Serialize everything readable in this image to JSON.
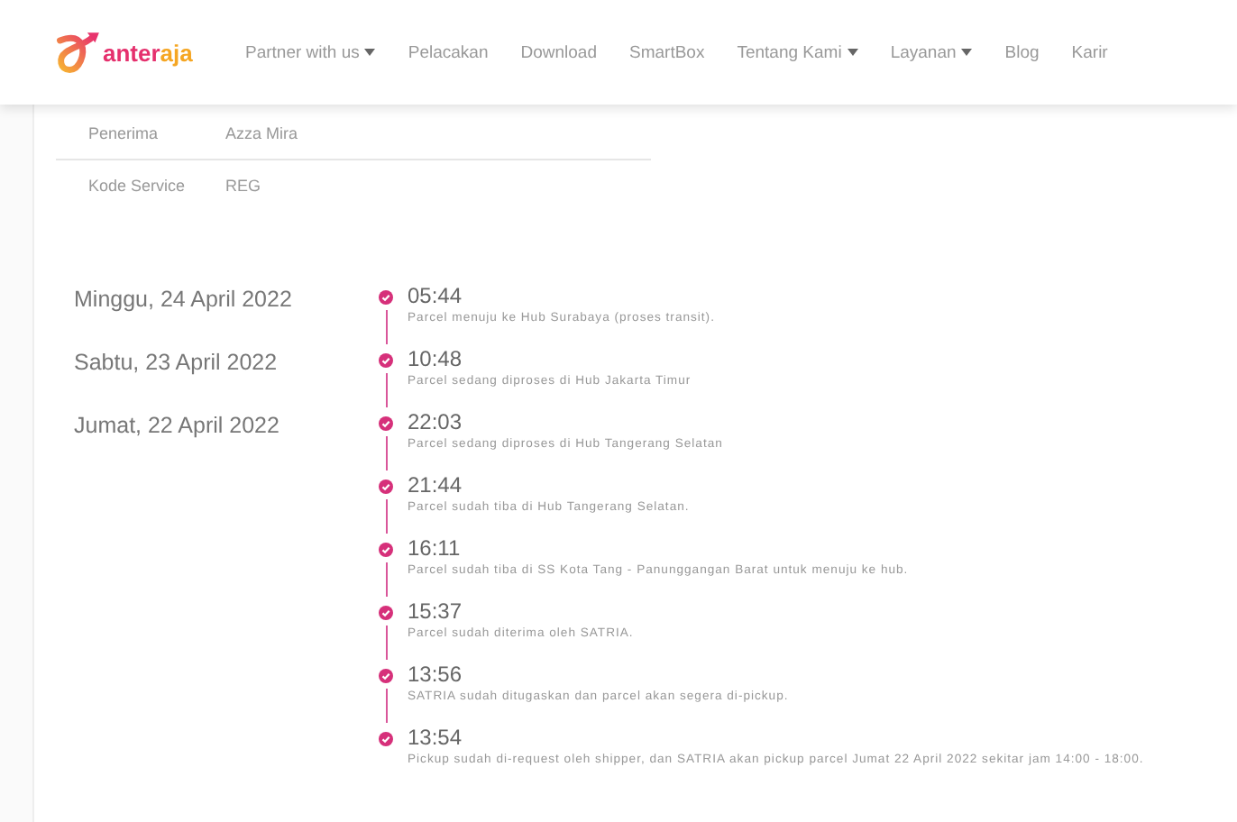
{
  "brand": {
    "parts": [
      "anter",
      "aja"
    ]
  },
  "nav": [
    {
      "label": "Partner with us",
      "dropdown": true
    },
    {
      "label": "Pelacakan",
      "dropdown": false
    },
    {
      "label": "Download",
      "dropdown": false
    },
    {
      "label": "SmartBox",
      "dropdown": false
    },
    {
      "label": "Tentang Kami",
      "dropdown": true
    },
    {
      "label": "Layanan",
      "dropdown": true
    },
    {
      "label": "Blog",
      "dropdown": false
    },
    {
      "label": "Karir",
      "dropdown": false
    }
  ],
  "details": [
    {
      "label": "Penerima",
      "value": "Azza Mira"
    },
    {
      "label": "Kode Service",
      "value": "REG"
    }
  ],
  "timeline": [
    {
      "date": "Minggu, 24 April 2022",
      "events": [
        {
          "time": "05:44",
          "text": "Parcel menuju ke Hub Surabaya (proses transit)."
        }
      ]
    },
    {
      "date": "Sabtu, 23 April 2022",
      "events": [
        {
          "time": "10:48",
          "text": "Parcel sedang diproses di Hub Jakarta Timur"
        }
      ]
    },
    {
      "date": "Jumat, 22 April 2022",
      "events": [
        {
          "time": "22:03",
          "text": "Parcel sedang diproses di Hub Tangerang Selatan"
        },
        {
          "time": "21:44",
          "text": "Parcel sudah tiba di Hub Tangerang Selatan."
        },
        {
          "time": "16:11",
          "text": "Parcel sudah tiba di SS Kota Tang - Panunggangan Barat untuk menuju ke hub."
        },
        {
          "time": "15:37",
          "text": "Parcel sudah diterima oleh SATRIA."
        },
        {
          "time": "13:56",
          "text": "SATRIA sudah ditugaskan dan parcel akan segera di-pickup."
        },
        {
          "time": "13:54",
          "text": "Pickup sudah di-request oleh shipper, dan SATRIA akan pickup parcel Jumat 22 April 2022 sekitar jam 14:00 - 18:00."
        }
      ]
    }
  ]
}
